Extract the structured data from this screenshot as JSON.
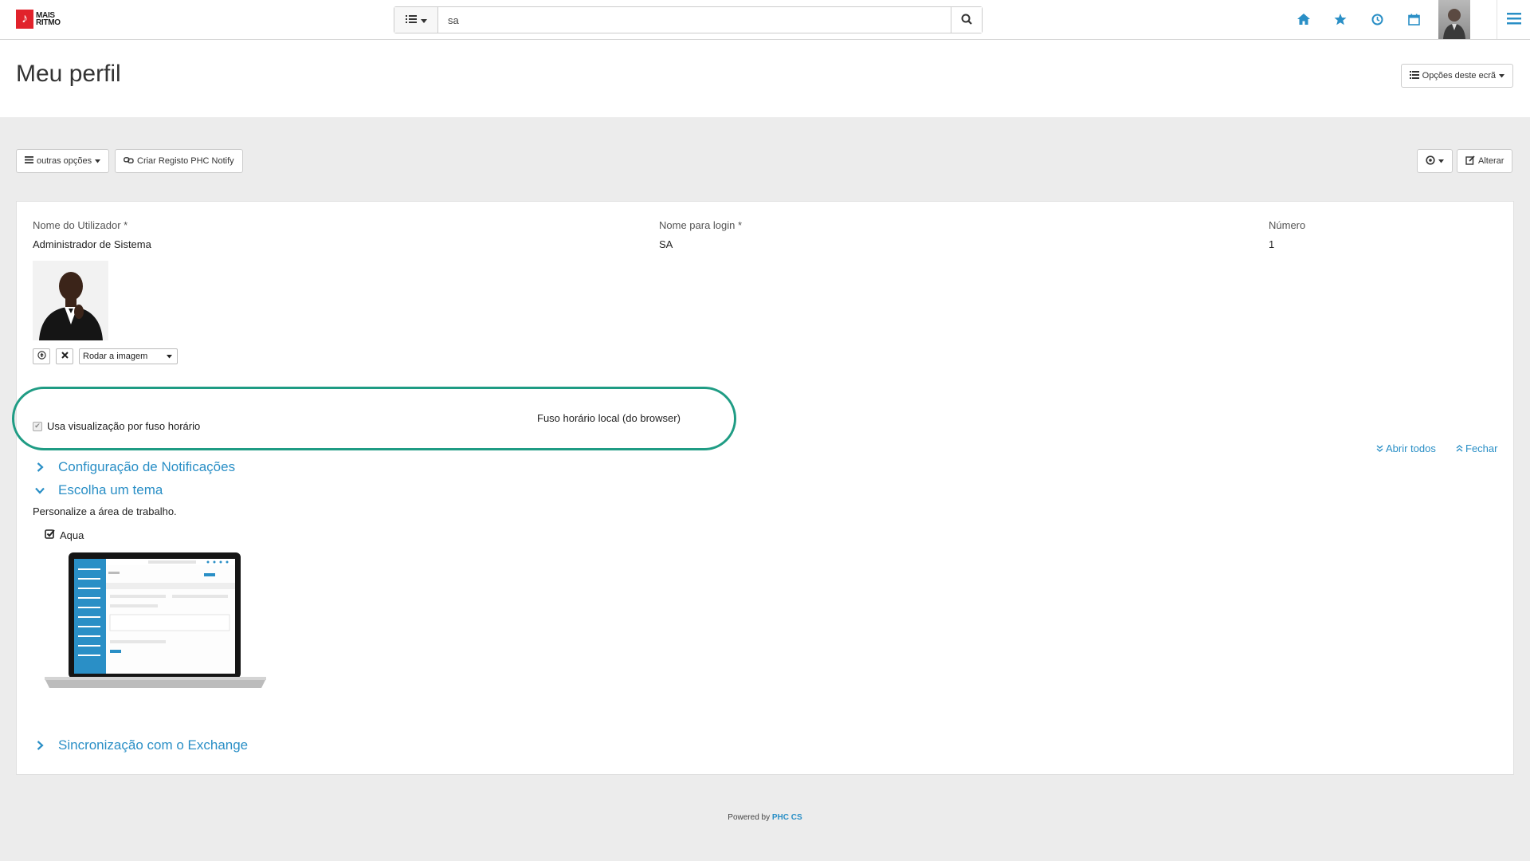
{
  "app": {
    "logo_line1": "MAIS",
    "logo_line2": "RITMO",
    "accent_color": "#2a8fc6",
    "highlight_color": "#1f9c84"
  },
  "search": {
    "value": "sa",
    "type_icon": "list-icon",
    "button_icon": "search-icon"
  },
  "nav": {
    "icons": [
      "home-icon",
      "star-icon",
      "clock-icon",
      "calendar-icon"
    ],
    "menu_icon": "hamburger-icon"
  },
  "header": {
    "title": "Meu perfil",
    "screen_options_label": "Opções deste ecrã"
  },
  "toolbar": {
    "other_options_label": "outras opções",
    "notify_label": "Criar Registo PHC Notify",
    "edit_label": "Alterar"
  },
  "profile": {
    "user_name_label": "Nome do Utilizador *",
    "user_name_value": "Administrador de Sistema",
    "login_label": "Nome para login *",
    "login_value": "SA",
    "number_label": "Número",
    "number_value": "1",
    "rotate_label": "Rodar a imagem"
  },
  "timezone": {
    "checkbox_label": "Usa visualização por fuso horário",
    "checked": true,
    "local_label": "Fuso horário local (do browser)"
  },
  "sections": {
    "open_all": "Abrir todos",
    "close": "Fechar",
    "notifications": "Configuração de Notificações",
    "theme": "Escolha um tema",
    "theme_desc": "Personalize a área de trabalho.",
    "theme_selected": "Aqua",
    "exchange": "Sincronização com o Exchange"
  },
  "footer": {
    "powered_by": "Powered by",
    "brand": "PHC CS"
  }
}
